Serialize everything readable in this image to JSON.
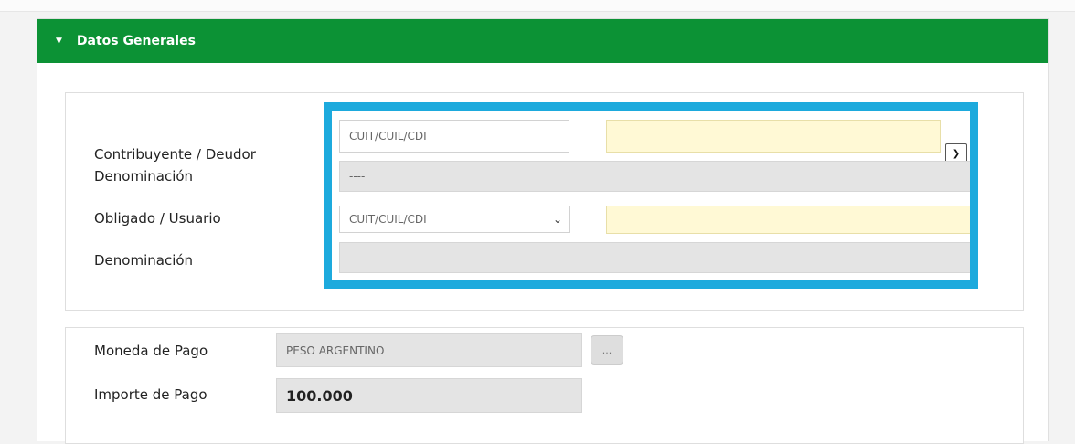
{
  "section": {
    "title": "Datos Generales",
    "header_color": "#0c9235",
    "highlight_color": "#1daadd"
  },
  "contribuyente": {
    "label": "Contribuyente / Deudor",
    "id_type": "CUIT/CUIL/CDI",
    "id_value": "",
    "denominacion_label": "Denominación",
    "denominacion_value": "----"
  },
  "obligado": {
    "label": "Obligado / Usuario",
    "id_type": "CUIT/CUIL/CDI",
    "id_value": "",
    "denominacion_label": "Denominación",
    "denominacion_value": ""
  },
  "pago": {
    "moneda_label": "Moneda de Pago",
    "moneda_value": "PESO ARGENTINO",
    "moneda_button": "...",
    "importe_label": "Importe de Pago",
    "importe_value": "100.000"
  }
}
